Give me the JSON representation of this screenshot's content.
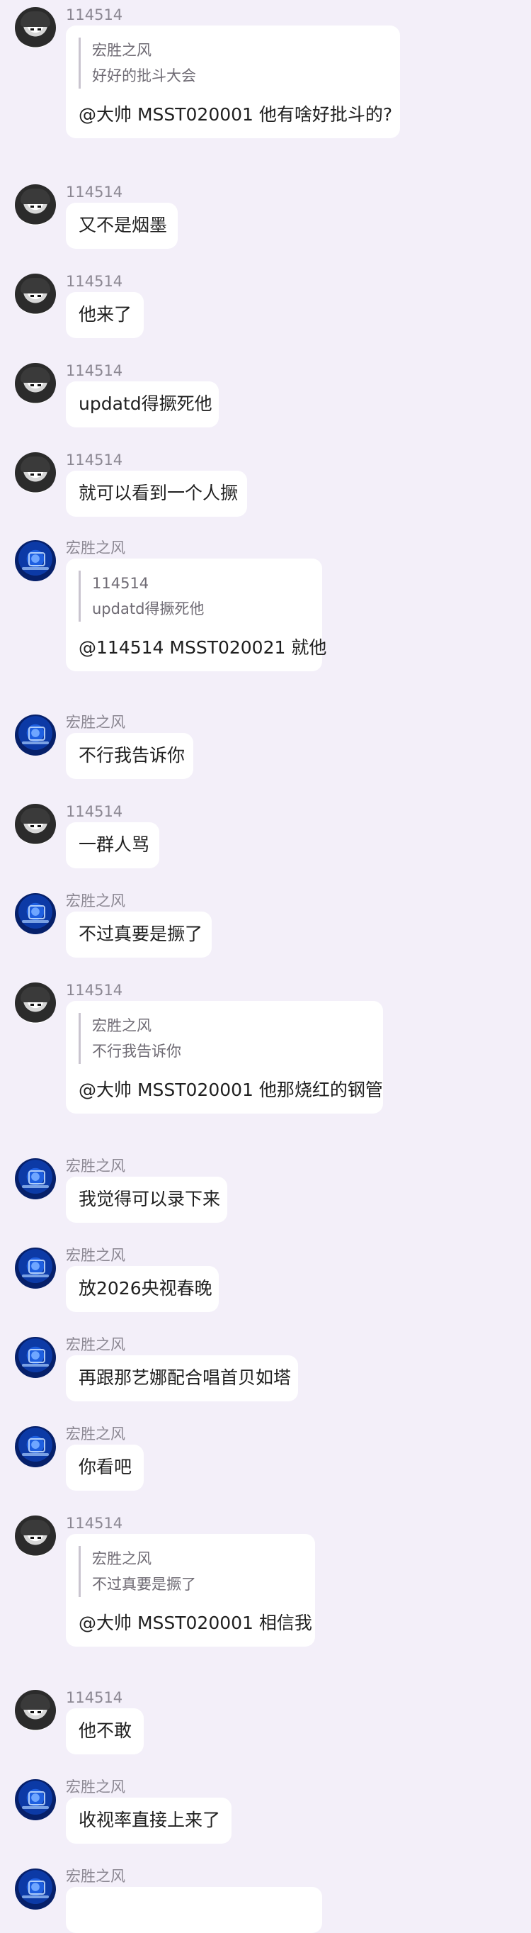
{
  "messages": [
    {
      "sender": "114514",
      "avatar": "anime-avatar",
      "quote": {
        "sender": "宏胜之风",
        "text": "好好的批斗大会"
      },
      "text": "@大帅 MSST020001 他有啥好批斗的?"
    },
    {
      "sender": "114514",
      "avatar": "anime-avatar",
      "text": "又不是烟墨"
    },
    {
      "sender": "114514",
      "avatar": "anime-avatar",
      "text": "他来了"
    },
    {
      "sender": "114514",
      "avatar": "anime-avatar",
      "text": "updatd得撅死他"
    },
    {
      "sender": "114514",
      "avatar": "anime-avatar",
      "text": "就可以看到一个人撅"
    },
    {
      "sender": "宏胜之风",
      "avatar": "blue-avatar",
      "quote": {
        "sender": "114514",
        "text": "updatd得撅死他"
      },
      "text": "@114514 MSST020021 就他"
    },
    {
      "sender": "宏胜之风",
      "avatar": "blue-avatar",
      "text": "不行我告诉你"
    },
    {
      "sender": "114514",
      "avatar": "anime-avatar",
      "text": "一群人骂"
    },
    {
      "sender": "宏胜之风",
      "avatar": "blue-avatar",
      "text": "不过真要是撅了"
    },
    {
      "sender": "114514",
      "avatar": "anime-avatar",
      "quote": {
        "sender": "宏胜之风",
        "text": "不行我告诉你"
      },
      "text": "@大帅 MSST020001 他那烧红的钢管"
    },
    {
      "sender": "宏胜之风",
      "avatar": "blue-avatar",
      "text": "我觉得可以录下来"
    },
    {
      "sender": "宏胜之风",
      "avatar": "blue-avatar",
      "text": "放2026央视春晚"
    },
    {
      "sender": "宏胜之风",
      "avatar": "blue-avatar",
      "text": "再跟那艺娜配合唱首贝如塔"
    },
    {
      "sender": "宏胜之风",
      "avatar": "blue-avatar",
      "text": "你看吧"
    },
    {
      "sender": "114514",
      "avatar": "anime-avatar",
      "quote": {
        "sender": "宏胜之风",
        "text": "不过真要是撅了"
      },
      "text": "@大帅 MSST020001 相信我"
    },
    {
      "sender": "114514",
      "avatar": "anime-avatar",
      "text": "他不敢"
    },
    {
      "sender": "宏胜之风",
      "avatar": "blue-avatar",
      "text": "收视率直接上来了"
    },
    {
      "sender": "宏胜之风",
      "avatar": "blue-avatar"
    }
  ]
}
